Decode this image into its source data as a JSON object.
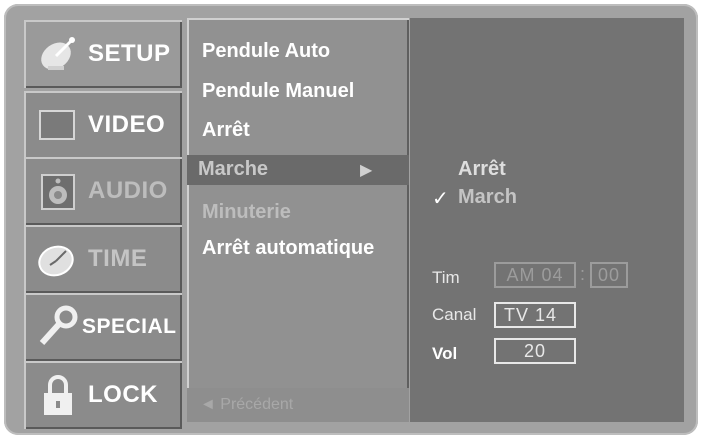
{
  "categories": [
    {
      "label": "SETUP",
      "icon": "satellite-dish-icon"
    },
    {
      "label": "VIDEO",
      "icon": "screen-icon"
    },
    {
      "label": "AUDIO",
      "icon": "speaker-icon"
    },
    {
      "label": "TIME",
      "icon": "clock-icon"
    },
    {
      "label": "SPECIAL",
      "icon": "key-icon"
    },
    {
      "label": "LOCK",
      "icon": "padlock-icon"
    }
  ],
  "submenu": {
    "items": [
      "Pendule Auto",
      "Pendule Manuel",
      "Arrêt",
      "Marche",
      "Minuterie",
      "Arrêt automatique"
    ],
    "selected": "Marche",
    "arrow": "▶",
    "prev": "◄ Précédent"
  },
  "panel": {
    "options": [
      "Arrêt",
      "March"
    ],
    "checked": "March",
    "check_mark": "✓",
    "time_label": "Tim",
    "time_value": "AM 04",
    "time_sep": ":",
    "time_minutes": "00",
    "channel_label": "Canal",
    "channel_value": "TV  14",
    "volume_label": "Vol",
    "volume_value": "20"
  }
}
